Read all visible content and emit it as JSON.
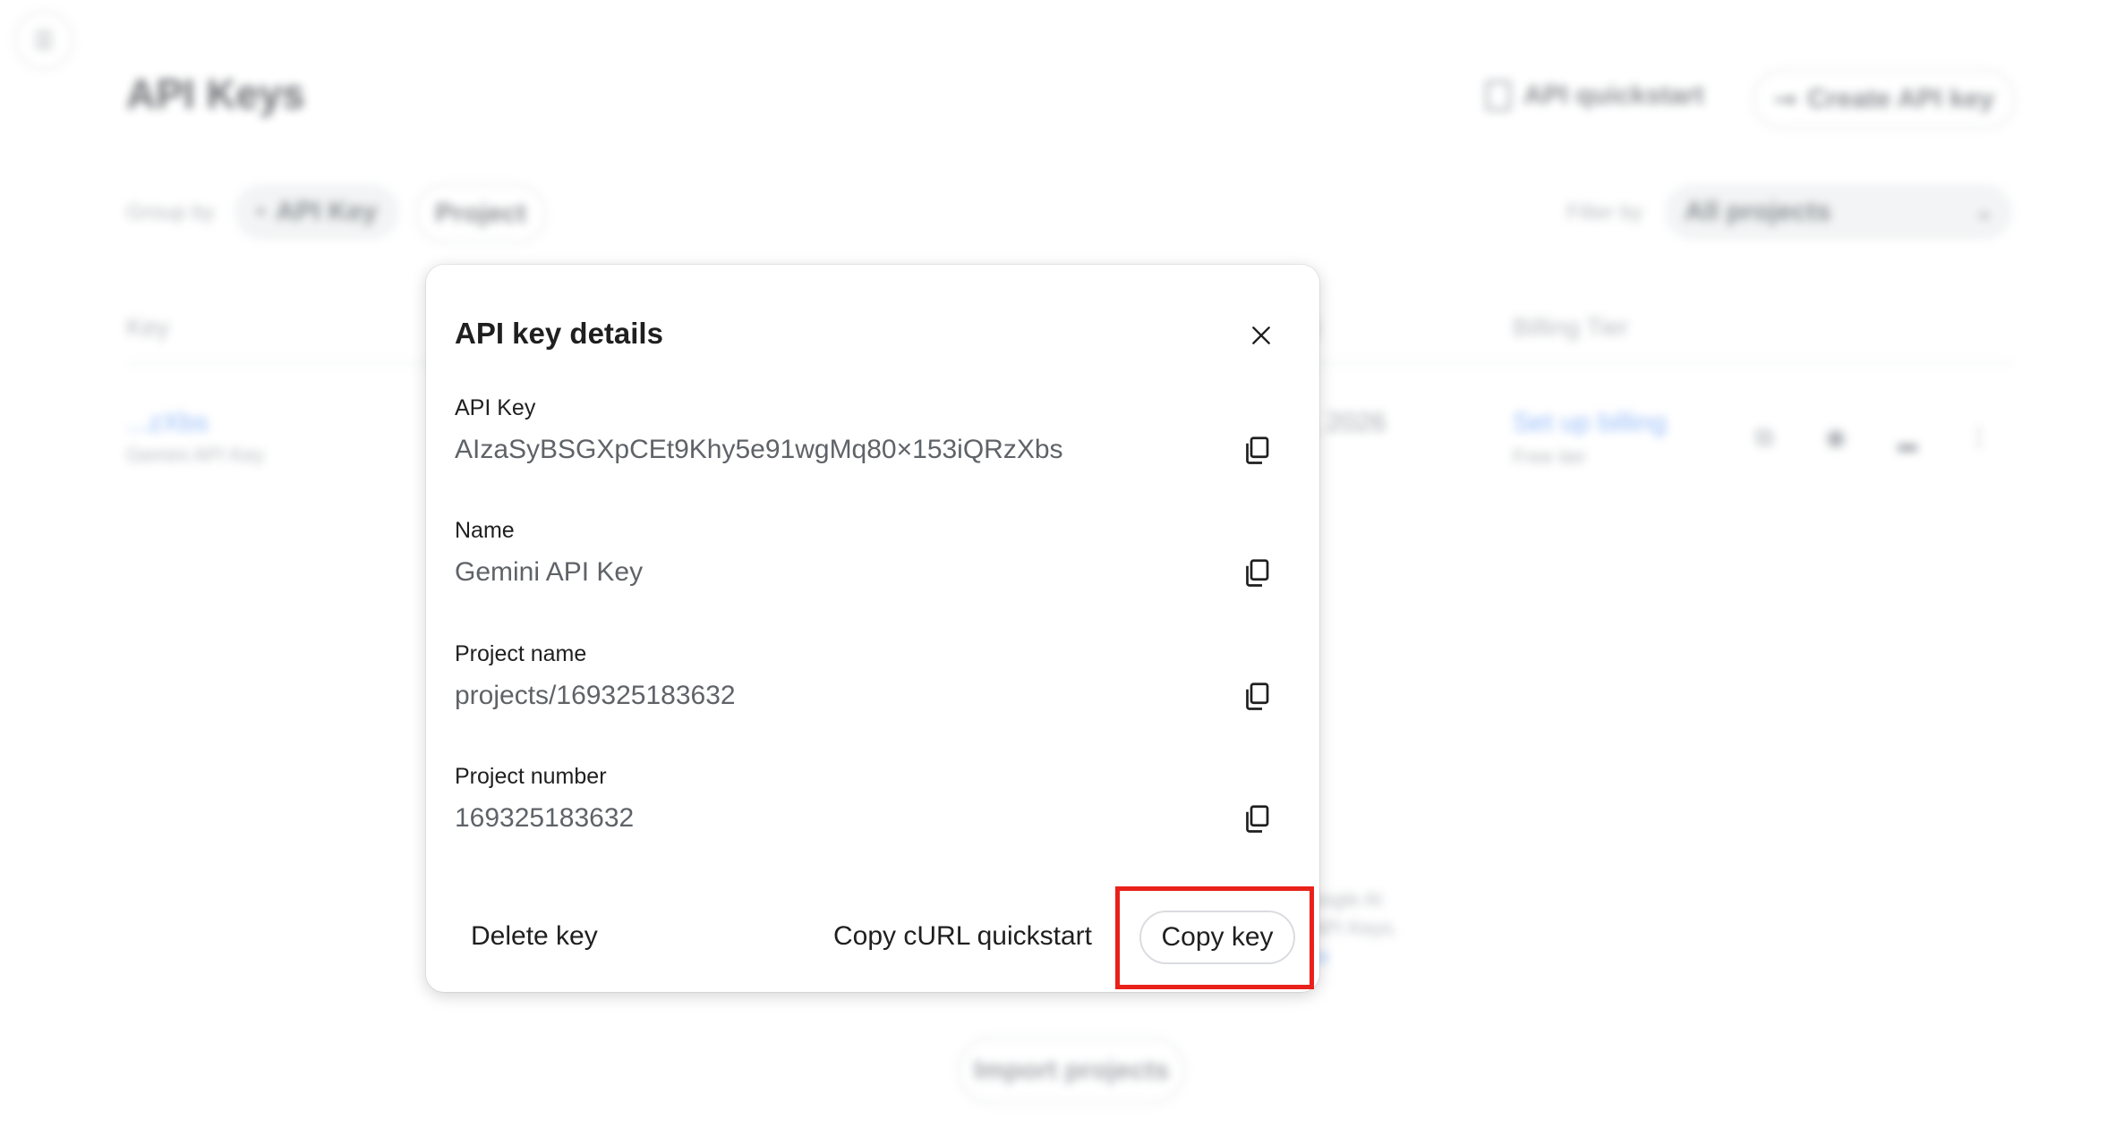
{
  "background": {
    "page_title": "API Keys",
    "quickstart_label": "API quickstart",
    "create_label": "Create API key",
    "group_by_label": "Group by",
    "group_chips": [
      "API Key",
      "Project"
    ],
    "filter_by_label": "Filter by",
    "filter_value": "All projects",
    "columns": {
      "key": "Key",
      "billing": "Billing Tier",
      "paren": ")"
    },
    "row": {
      "key": "...zXbs",
      "name": "Gemini API Key",
      "date": ", 2026",
      "billing": "Set up billing",
      "tier": "Free tier"
    },
    "note_lines": [
      "oogle AI",
      "API Keys.",
      "re"
    ],
    "import_label": "Import projects"
  },
  "dialog": {
    "title": "API key details",
    "fields": [
      {
        "label": "API Key",
        "value": "AIzaSyBSGXpCEt9Khy5e91wgMq80×153iQRzXbs"
      },
      {
        "label": "Name",
        "value": "Gemini API Key"
      },
      {
        "label": "Project name",
        "value": "projects/169325183632"
      },
      {
        "label": "Project number",
        "value": "169325183632"
      }
    ],
    "delete_label": "Delete key",
    "curl_label": "Copy cURL quickstart",
    "copy_key_label": "Copy key"
  },
  "colors": {
    "highlight": "#e8211a",
    "link": "#1a73e8"
  }
}
